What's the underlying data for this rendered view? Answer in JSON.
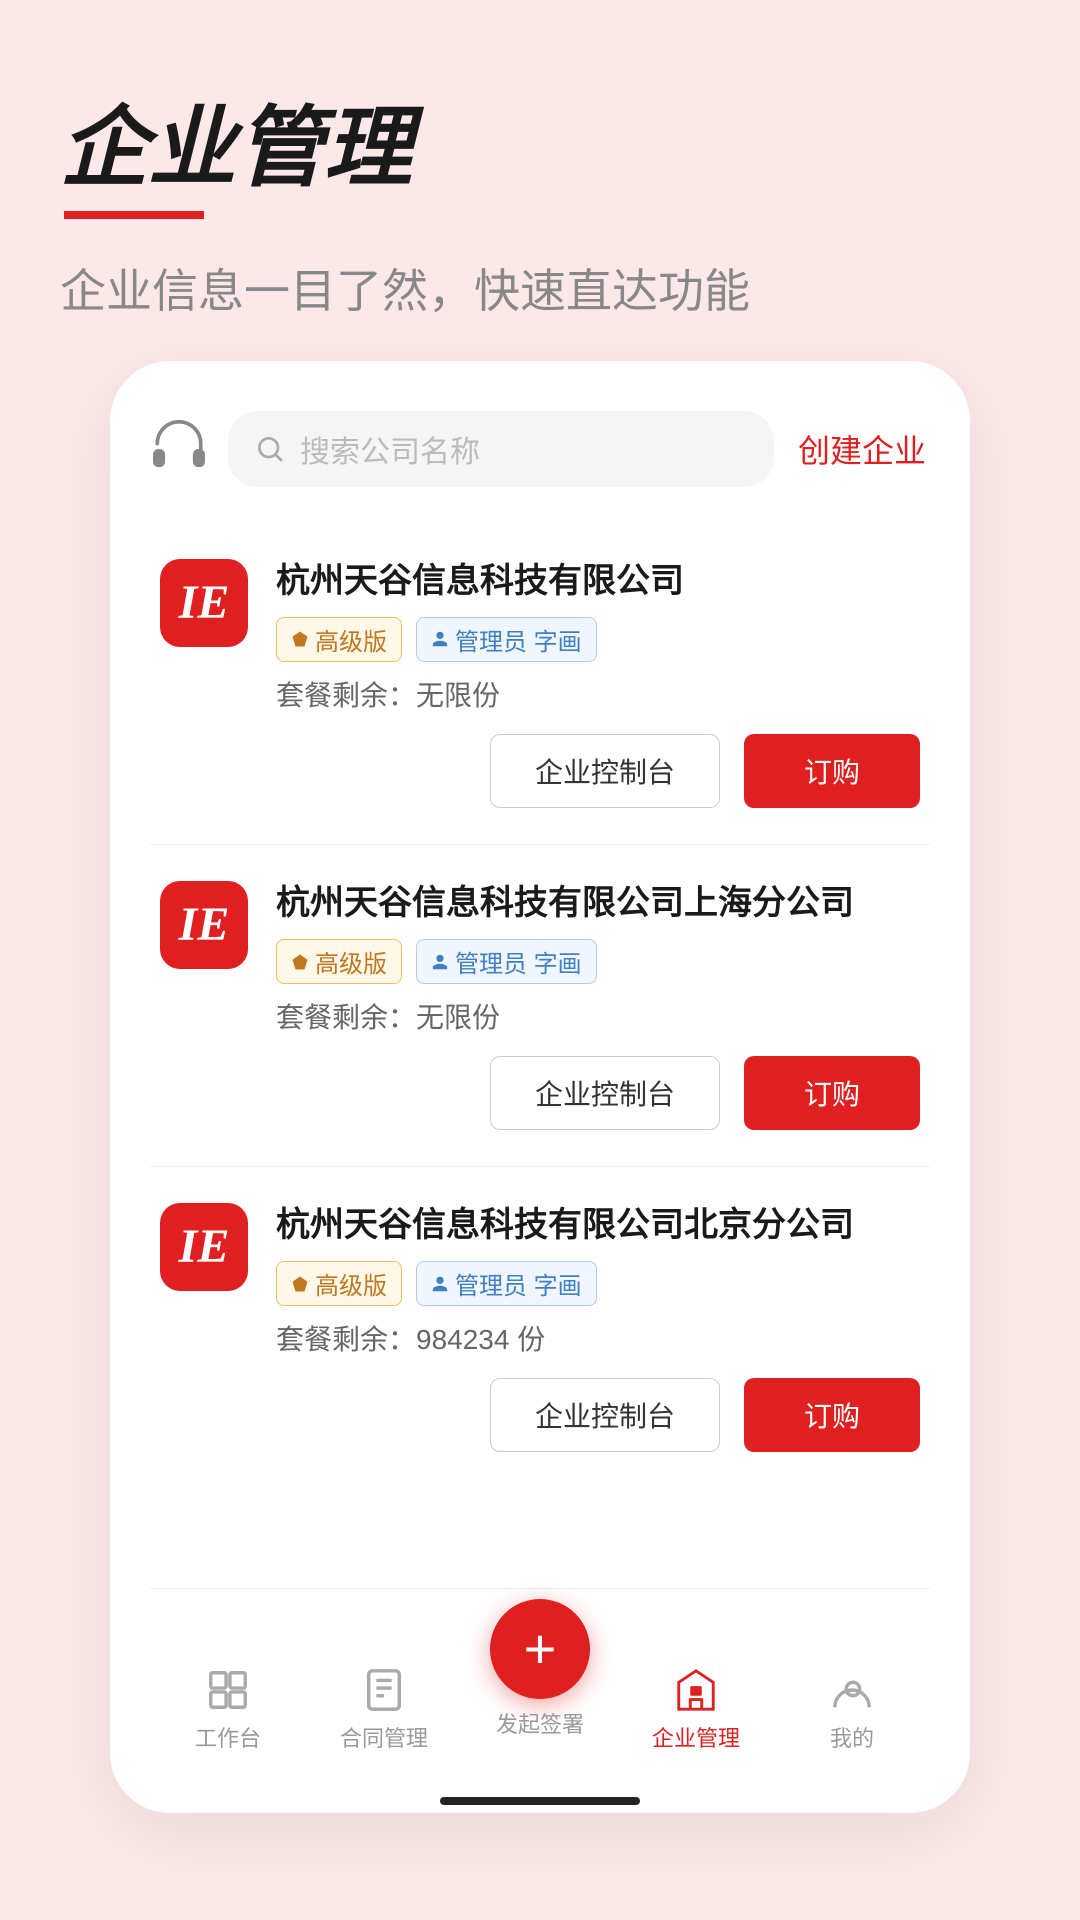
{
  "header": {
    "title": "企业管理",
    "subtitle": "企业信息一目了然，快速直达功能"
  },
  "search": {
    "placeholder": "搜索公司名称",
    "create_label": "创建企业"
  },
  "companies": [
    {
      "id": 1,
      "name": "杭州天谷信息科技有限公司",
      "tier": "高级版",
      "role": "管理员 字画",
      "quota_label": "套餐剩余：",
      "quota_value": "无限份",
      "btn_control": "企业控制台",
      "btn_order": "订购"
    },
    {
      "id": 2,
      "name": "杭州天谷信息科技有限公司上海分公司",
      "tier": "高级版",
      "role": "管理员 字画",
      "quota_label": "套餐剩余：",
      "quota_value": "无限份",
      "btn_control": "企业控制台",
      "btn_order": "订购"
    },
    {
      "id": 3,
      "name": "杭州天谷信息科技有限公司北京分公司",
      "tier": "高级版",
      "role": "管理员 字画",
      "quota_label": "套餐剩余：",
      "quota_value": "984234 份",
      "btn_control": "企业控制台",
      "btn_order": "订购"
    }
  ],
  "nav": {
    "items": [
      {
        "label": "工作台",
        "active": false
      },
      {
        "label": "合同管理",
        "active": false
      },
      {
        "label": "发起签署",
        "active": false,
        "is_fab": true
      },
      {
        "label": "企业管理",
        "active": true
      },
      {
        "label": "我的",
        "active": false
      }
    ]
  },
  "logo_text": "IE"
}
